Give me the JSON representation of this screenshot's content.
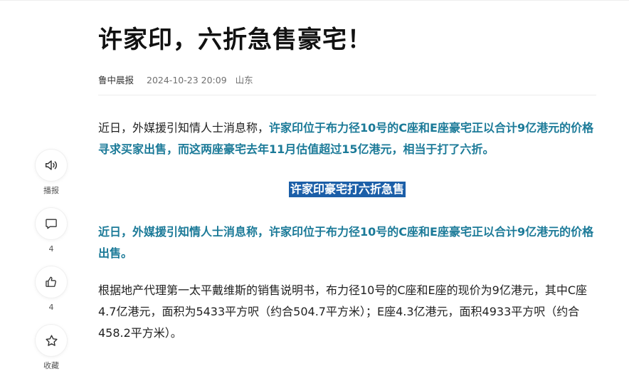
{
  "article": {
    "title": "许家印，六折急售豪宅！",
    "source": "鲁中晨报",
    "time": "2024-10-23 20:09",
    "location": "山东",
    "p1_lead": "近日，外媒援引知情人士消息称，",
    "p1_highlight": "许家印位于布力径10号的C座和E座豪宅正以合计9亿港元的价格寻求买家出售，而这两座豪宅去年11月估值超过15亿港元，相当于打了六折。",
    "subheading": "许家印豪宅打六折急售",
    "p2": "近日，外媒援引知情人士消息称，许家印位于布力径10号的C座和E座豪宅正以合计9亿港元的价格出售。",
    "p3": "根据地产代理第一太平戴维斯的销售说明书，布力径10号的C座和E座的现价为9亿港元，其中C座4.7亿港元，面积为5433平方呎（约合504.7平方米）；E座4.3亿港元，面积4933平方呎（约合458.2平方米）。"
  },
  "rail": {
    "play_label": "播报",
    "comment_count": "4",
    "like_count": "4",
    "favorite_label": "收藏"
  },
  "icons": {
    "play": "speaker-icon",
    "comment": "comment-bubble-icon",
    "like": "thumbs-up-icon",
    "favorite": "star-icon"
  },
  "colors": {
    "highlight_text": "#1b7a98",
    "subheading_bg": "#1c5fa8"
  }
}
